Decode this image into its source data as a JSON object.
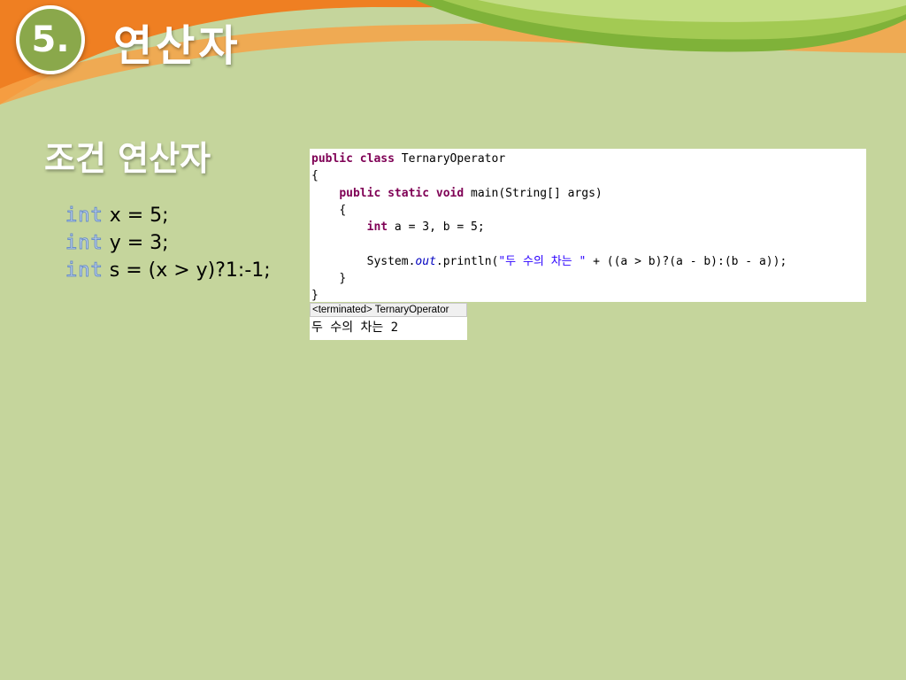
{
  "slide": {
    "number": "5.",
    "title": "연산자",
    "subtitle": "조건 연산자"
  },
  "snippet": {
    "keyword": "int",
    "lines": [
      " x = 5;",
      " y = 3;",
      " s = (x > y)?1:-1;"
    ]
  },
  "code": {
    "line1_kw": "public class",
    "line1_rest": " TernaryOperator",
    "line2": "{",
    "line3_kw": "public static void",
    "line3_rest": " main(String[] args)",
    "line4": "{",
    "line5_kw": "int",
    "line5_rest": " a = 3, b = 5;",
    "line7_a": "System.",
    "line7_field": "out",
    "line7_b": ".println(",
    "line7_str": "\"두 수의 차는 \"",
    "line7_c": " + ((a > b)?(a - b):(b - a));",
    "line8": "}",
    "line9": "}"
  },
  "console": {
    "header": "<terminated> TernaryOperator",
    "output": "두 수의 차는 2"
  },
  "colors": {
    "background": "#c5d59c",
    "accent_orange": "#ef7f22",
    "accent_green": "#8aa84b",
    "keyword": "#7f0055",
    "string": "#2a00ff"
  }
}
